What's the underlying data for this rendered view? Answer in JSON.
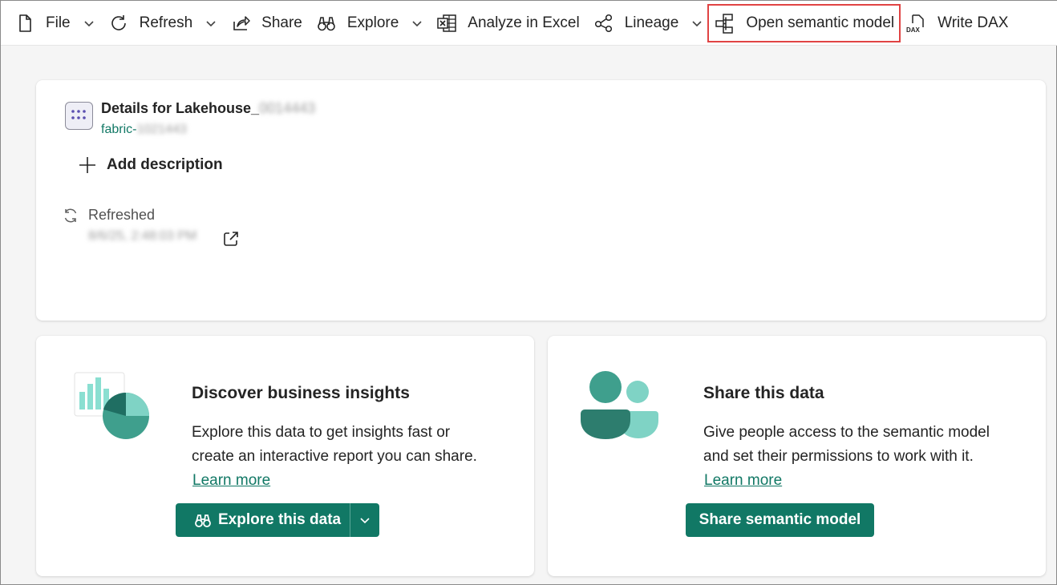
{
  "toolbar": {
    "file": "File",
    "refresh": "Refresh",
    "share": "Share",
    "explore": "Explore",
    "analyze": "Analyze in Excel",
    "lineage": "Lineage",
    "open_model": "Open semantic model",
    "write_dax": "Write DAX"
  },
  "details": {
    "title": "Details for Lakehouse_",
    "title_redacted": "0014443",
    "subtitle": "fabric-",
    "subtitle_redacted": "1021443",
    "add_description": "Add description",
    "refreshed_label": "Refreshed",
    "refreshed_time_redacted": "8/6/25, 2:48:03 PM"
  },
  "insights": {
    "title": "Discover business insights",
    "text_line1": "Explore this data to get insights fast or",
    "text_line2": "create an interactive report you can share.",
    "learn_more": "Learn more",
    "button": "Explore this data"
  },
  "share": {
    "title": "Share this data",
    "text_line1": "Give people access to the semantic model",
    "text_line2": "and set their permissions to work with it.",
    "learn_more": "Learn more",
    "button": "Share semantic model"
  },
  "colors": {
    "accent": "#117865",
    "highlight_border": "#e04343",
    "illustration_dark": "#2d7d6e",
    "illustration_light": "#7fd3c5"
  }
}
